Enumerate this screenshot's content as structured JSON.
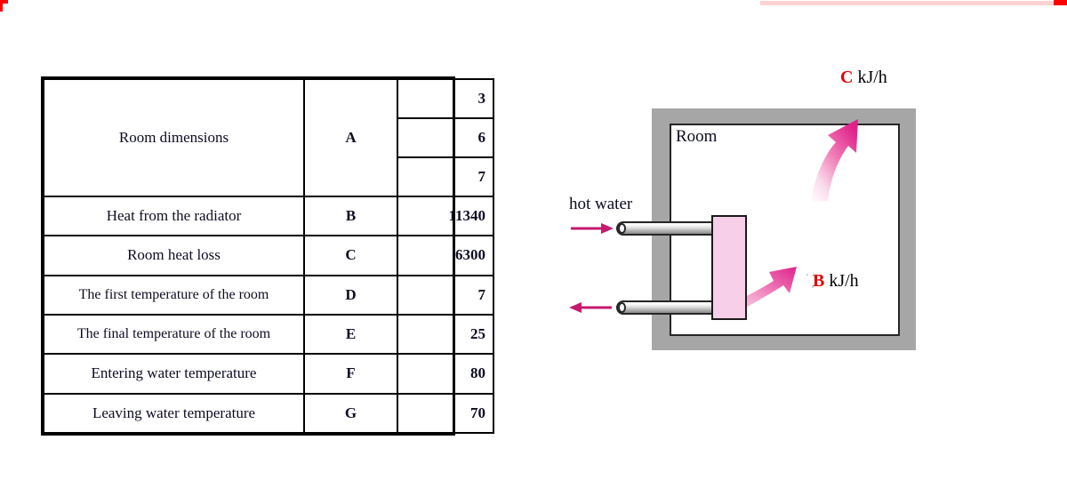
{
  "table": {
    "rows": [
      {
        "label": "Room dimensions",
        "key": "A",
        "values": [
          "3",
          "6",
          "7"
        ],
        "multi": true
      },
      {
        "label": "Heat from the radiator",
        "key": "B",
        "values": [
          "11340"
        ]
      },
      {
        "label": "Room heat loss",
        "key": "C",
        "values": [
          "6300"
        ]
      },
      {
        "label": "The first temperature of the room",
        "key": "D",
        "values": [
          "7"
        ]
      },
      {
        "label": "The final temperature of the room",
        "key": "E",
        "values": [
          "25"
        ]
      },
      {
        "label": "Entering water temperature",
        "key": "F",
        "values": [
          "80"
        ]
      },
      {
        "label": "Leaving water temperature",
        "key": "G",
        "values": [
          "70"
        ]
      }
    ]
  },
  "diagram": {
    "room_label": "Room",
    "hot_water_label": "hot water",
    "heat_out_key": "C",
    "heat_out_unit": "kJ/h",
    "heat_in_key": "B",
    "heat_in_unit": "kJ/h"
  },
  "colors": {
    "key_red": "#ff0000",
    "tag_red": "#e00000",
    "wall_gray": "#a6a6a6",
    "radiator_pink": "#f8cfe8",
    "arrow_magenta": "#e0218a",
    "flow_arrow": "#c41b6e"
  }
}
